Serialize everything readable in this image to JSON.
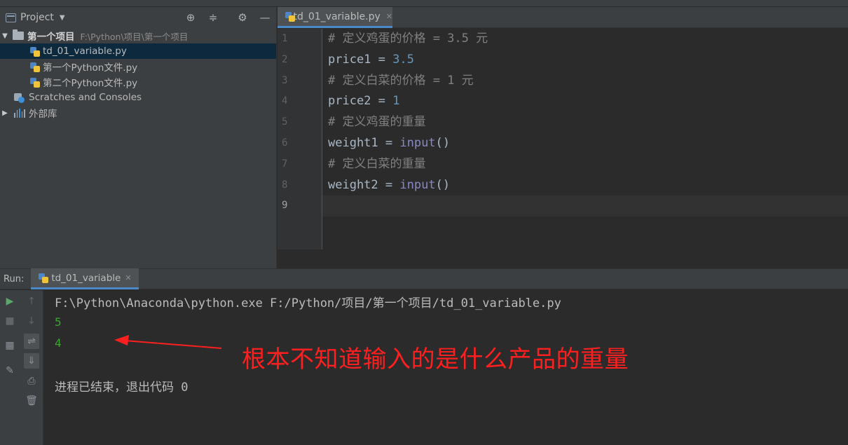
{
  "project_panel": {
    "title": "Project",
    "root": {
      "name": "第一个项目",
      "path": "F:\\Python\\项目\\第一个项目"
    },
    "files": [
      "td_01_variable.py",
      "第一个Python文件.py",
      "第二个Python文件.py"
    ],
    "scratches": "Scratches and Consoles",
    "external_libs": "外部库",
    "selected_file": "td_01_variable.py"
  },
  "editor": {
    "tab_label": "td_01_variable.py",
    "line_numbers": [
      "1",
      "2",
      "3",
      "4",
      "5",
      "6",
      "7",
      "8",
      "9"
    ],
    "current_line": 9,
    "lines": [
      [
        {
          "t": "# 定义鸡蛋的价格 = 3.5 元",
          "c": "cmt"
        }
      ],
      [
        {
          "t": "price1 = ",
          "c": ""
        },
        {
          "t": "3.5",
          "c": "num"
        }
      ],
      [
        {
          "t": "# 定义白菜的价格 = 1 元",
          "c": "cmt"
        }
      ],
      [
        {
          "t": "price2 = ",
          "c": ""
        },
        {
          "t": "1",
          "c": "num"
        }
      ],
      [
        {
          "t": "# 定义鸡蛋的重量",
          "c": "cmt"
        }
      ],
      [
        {
          "t": "weight1 = ",
          "c": ""
        },
        {
          "t": "input",
          "c": "bi"
        },
        {
          "t": "()",
          "c": ""
        }
      ],
      [
        {
          "t": "# 定义白菜的重量",
          "c": "cmt"
        }
      ],
      [
        {
          "t": "weight2 = ",
          "c": ""
        },
        {
          "t": "input",
          "c": "bi"
        },
        {
          "t": "()",
          "c": ""
        }
      ],
      []
    ]
  },
  "run_panel": {
    "label": "Run:",
    "tab_label": "td_01_variable",
    "command": "F:\\Python\\Anaconda\\python.exe F:/Python/项目/第一个项目/td_01_variable.py",
    "inputs": [
      "5",
      "4"
    ],
    "exit_message": "进程已结束，退出代码 0"
  },
  "annotation": {
    "text": "根本不知道输入的是什么产品的重量",
    "color": "#ff1f1f"
  },
  "colors": {
    "comment": "#808080",
    "number": "#6897bb",
    "builtin": "#8888c6",
    "console_input": "#3ea531",
    "accent": "#4a88c7"
  },
  "icons": [
    "project-view-icon",
    "locate-icon",
    "collapse-icon",
    "gear-icon",
    "minimize-icon",
    "folder-icon",
    "python-file-icon",
    "scratches-icon",
    "library-icon",
    "run-icon",
    "stop-icon",
    "up-icon",
    "down-icon",
    "layout-icon",
    "soft-wrap-icon",
    "scroll-to-end-icon",
    "pin-icon",
    "print-icon",
    "trash-icon"
  ]
}
